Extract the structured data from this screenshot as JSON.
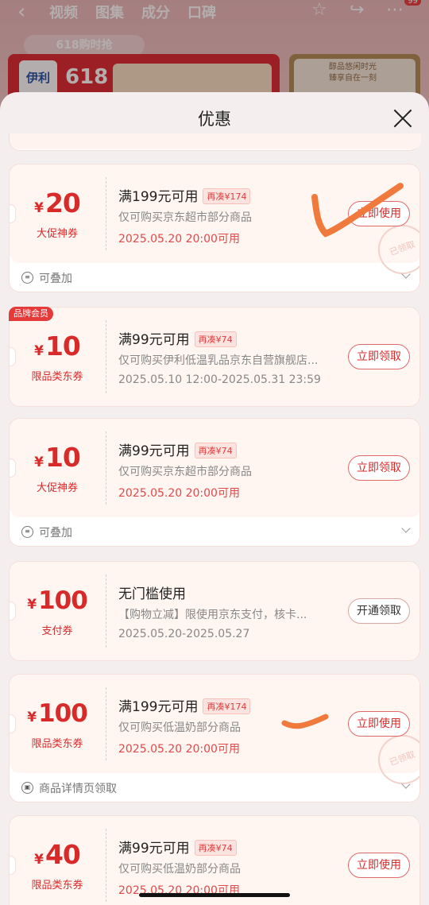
{
  "background": {
    "nav_tabs": [
      "视频",
      "图集",
      "成分",
      "口碑"
    ],
    "badge": "99",
    "promo_pill": "618购时抢",
    "banner_logo": "伊利",
    "banner_event": "618",
    "side_card_text": [
      "醇品悠闲时光",
      "臻享自在一刻"
    ]
  },
  "sheet": {
    "title": "优惠"
  },
  "coupons": [
    {
      "amount": "20",
      "currency": "¥",
      "type": "大促神券",
      "condition": "满199元可用",
      "tag": "再凑¥174",
      "description": "仅可购买京东超市部分商品",
      "time": "2025.05.20 20:00可用",
      "action": "立即使用",
      "stamp": "已领取",
      "footer": "可叠加"
    },
    {
      "brand_tag": "品牌会员",
      "amount": "10",
      "currency": "¥",
      "type": "限品类东券",
      "condition": "满99元可用",
      "tag": "再凑¥74",
      "description": "仅可购买伊利低温乳品京东自营旗舰店...",
      "time": "2025.05.10 12:00-2025.05.31 23:59",
      "action": "立即领取"
    },
    {
      "amount": "10",
      "currency": "¥",
      "type": "大促神券",
      "condition": "满99元可用",
      "tag": "再凑¥74",
      "description": "仅可购买京东超市部分商品",
      "time": "2025.05.20 20:00可用",
      "action": "立即领取",
      "footer": "可叠加"
    },
    {
      "amount": "100",
      "currency": "¥",
      "type": "支付券",
      "condition": "无门槛使用",
      "description": "【购物立减】限使用京东支付，核卡...",
      "time": "2025.05.20-2025.05.27",
      "action": "开通领取"
    },
    {
      "amount": "100",
      "currency": "¥",
      "type": "限品类东券",
      "condition": "满199元可用",
      "tag": "再凑¥174",
      "description": "仅可购买低温奶部分商品",
      "time": "2025.05.20 20:00可用",
      "action": "立即使用",
      "stamp": "已领取",
      "footer": "商品详情页领取"
    },
    {
      "amount": "40",
      "currency": "¥",
      "type": "限品类东券",
      "condition": "满99元可用",
      "tag": "再凑¥74",
      "description": "仅可购买低温奶部分商品",
      "time": "2025.05.20 20:00可用",
      "action": "立即使用"
    }
  ],
  "colors": {
    "accent": "#d92a2a",
    "scribble": "#f07a3c",
    "card_bg": "#fff5f1"
  }
}
